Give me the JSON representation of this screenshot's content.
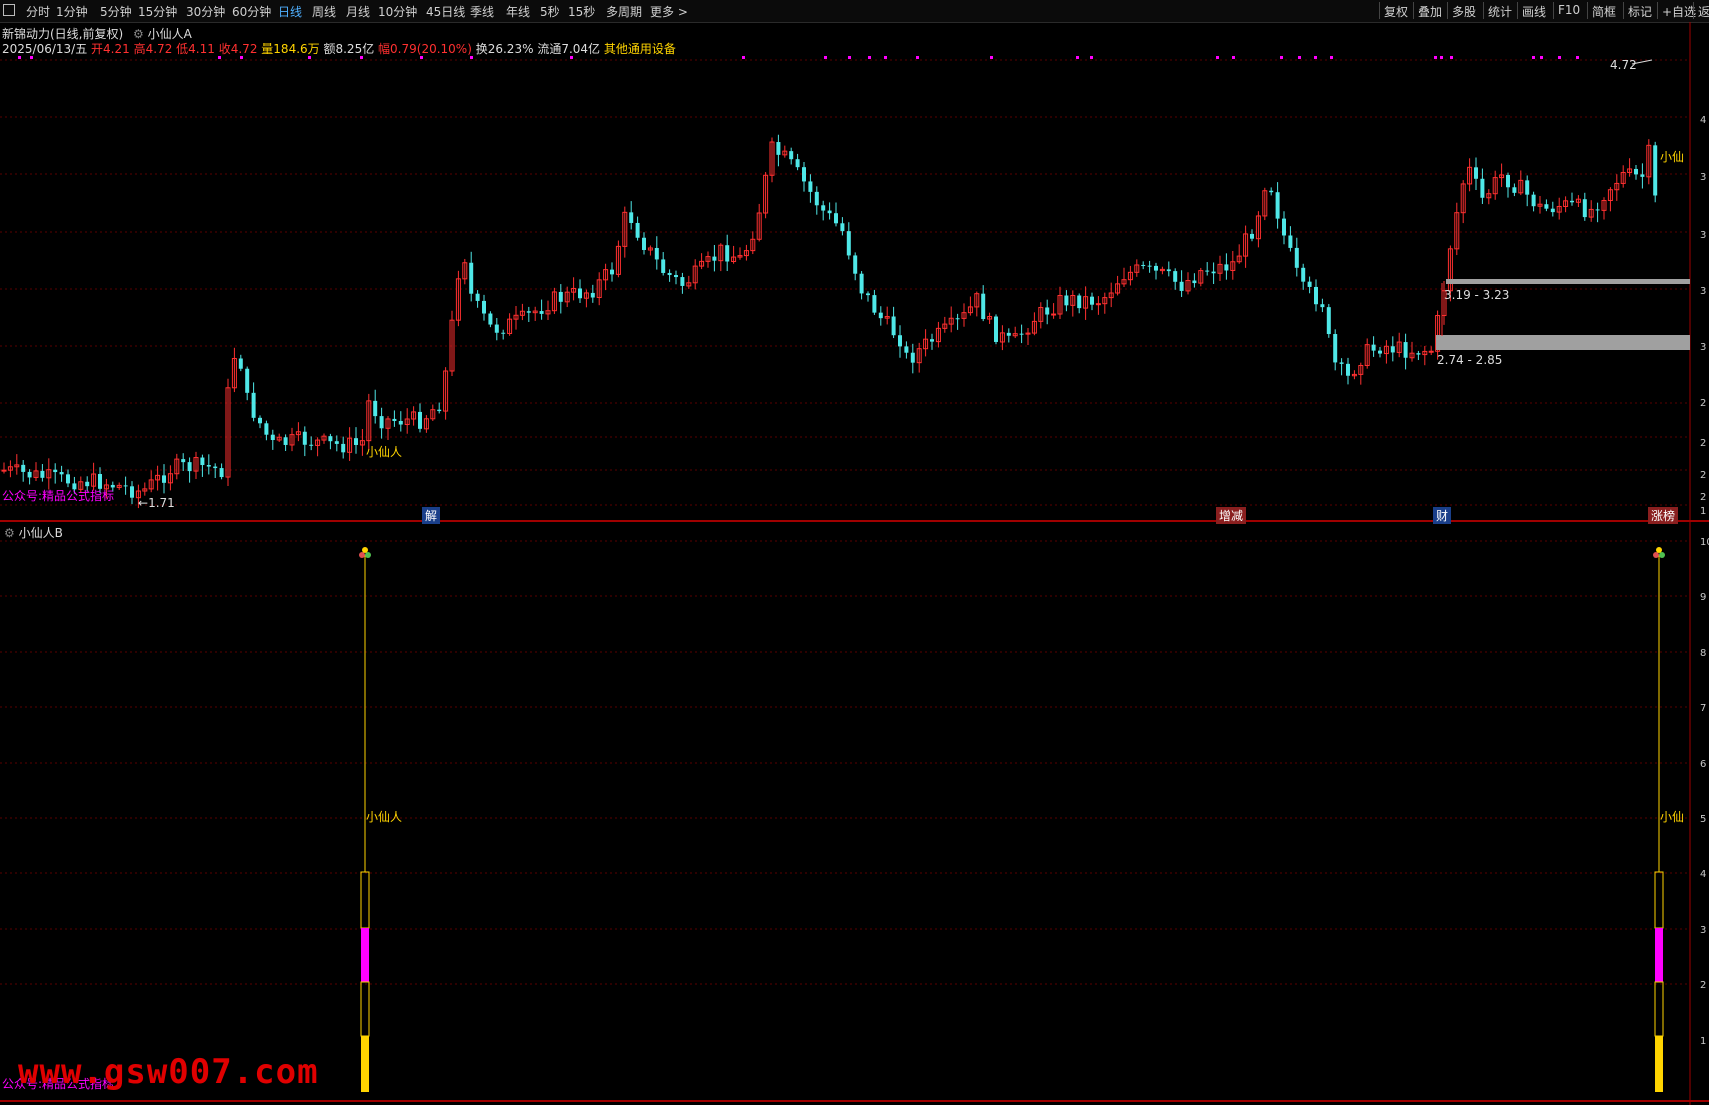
{
  "toolbar": {
    "left_items": [
      "分时",
      "1分钟",
      "5分钟",
      "15分钟",
      "30分钟",
      "60分钟",
      "日线",
      "周线",
      "月线",
      "10分钟",
      "45日线",
      "季线",
      "年线",
      "5秒",
      "15秒",
      "多周期",
      "更多 >"
    ],
    "active": "日线",
    "right_items": [
      "复权",
      "叠加",
      "多股",
      "统计",
      "画线",
      "F10",
      "简框",
      "标记",
      "+自选",
      "返"
    ]
  },
  "header": {
    "title": "新锦动力(日线,前复权)",
    "indicator_a": "小仙人A",
    "date": "2025/06/13/五",
    "open": "开4.21",
    "high": "高4.72",
    "low": "低4.11",
    "close": "收4.72",
    "volume": "量184.6万",
    "amount": "额8.25亿",
    "change": "幅0.79(20.10%)",
    "turnover": "换26.23%",
    "float": "流通7.04亿",
    "sector": "其他通用设备"
  },
  "main_chart": {
    "high_label": "4.72",
    "low_label": "1.71",
    "signal_label_1": "小仙人",
    "signal_label_2": "小仙",
    "zone_upper": "3.19 - 3.23",
    "zone_lower": "2.74 - 2.85",
    "left_watermark": "公众号:精品公式指标",
    "event_markers": [
      "解",
      "增减",
      "财",
      "涨榜"
    ]
  },
  "sub_chart": {
    "title": "小仙人B",
    "signal_label_1": "小仙人",
    "signal_label_2": "小仙",
    "left_watermark": "公众号:精品公式指标"
  },
  "watermark": "www.gsw007.com",
  "right_axis_main": [
    "4",
    "3",
    "3",
    "3",
    "3",
    "2",
    "2",
    "2",
    "2",
    "1"
  ],
  "right_axis_sub": [
    "10",
    "9",
    "8",
    "7",
    "6",
    "5",
    "4",
    "3",
    "2",
    "1"
  ],
  "colors": {
    "up": "#ff3030",
    "down": "#4fe8e8",
    "magenta": "#ff00ff",
    "yellow": "#ffd400",
    "grid": "#5a0000"
  }
}
